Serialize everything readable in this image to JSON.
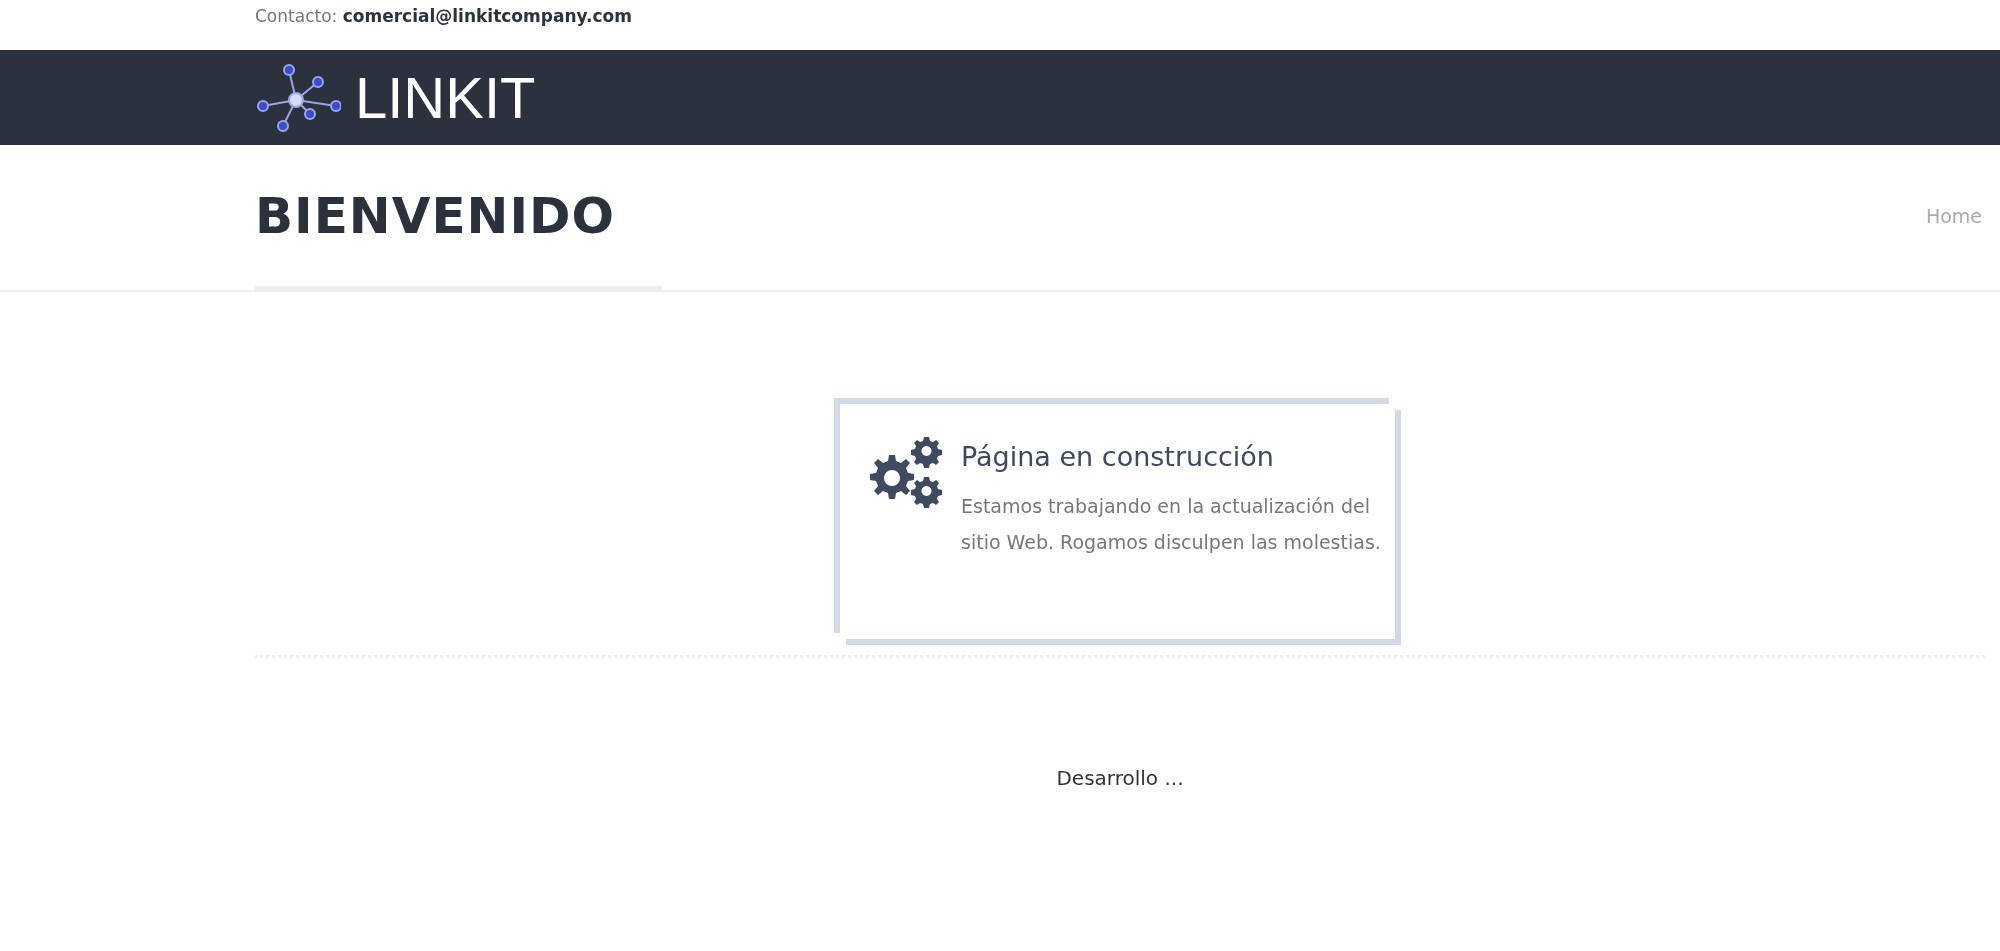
{
  "topbar": {
    "label": "Contacto:",
    "email": "comercial@linkitcompany.com"
  },
  "header": {
    "brand": "LINKIT"
  },
  "title_bar": {
    "title": "BIENVENIDO",
    "breadcrumb": "Home"
  },
  "notice": {
    "title": "Página en construcción",
    "message": "Estamos trabajando en la actualización del sitio Web. Rogamos disculpen las molestias."
  },
  "footer": {
    "text": "Desarrollo ..."
  }
}
